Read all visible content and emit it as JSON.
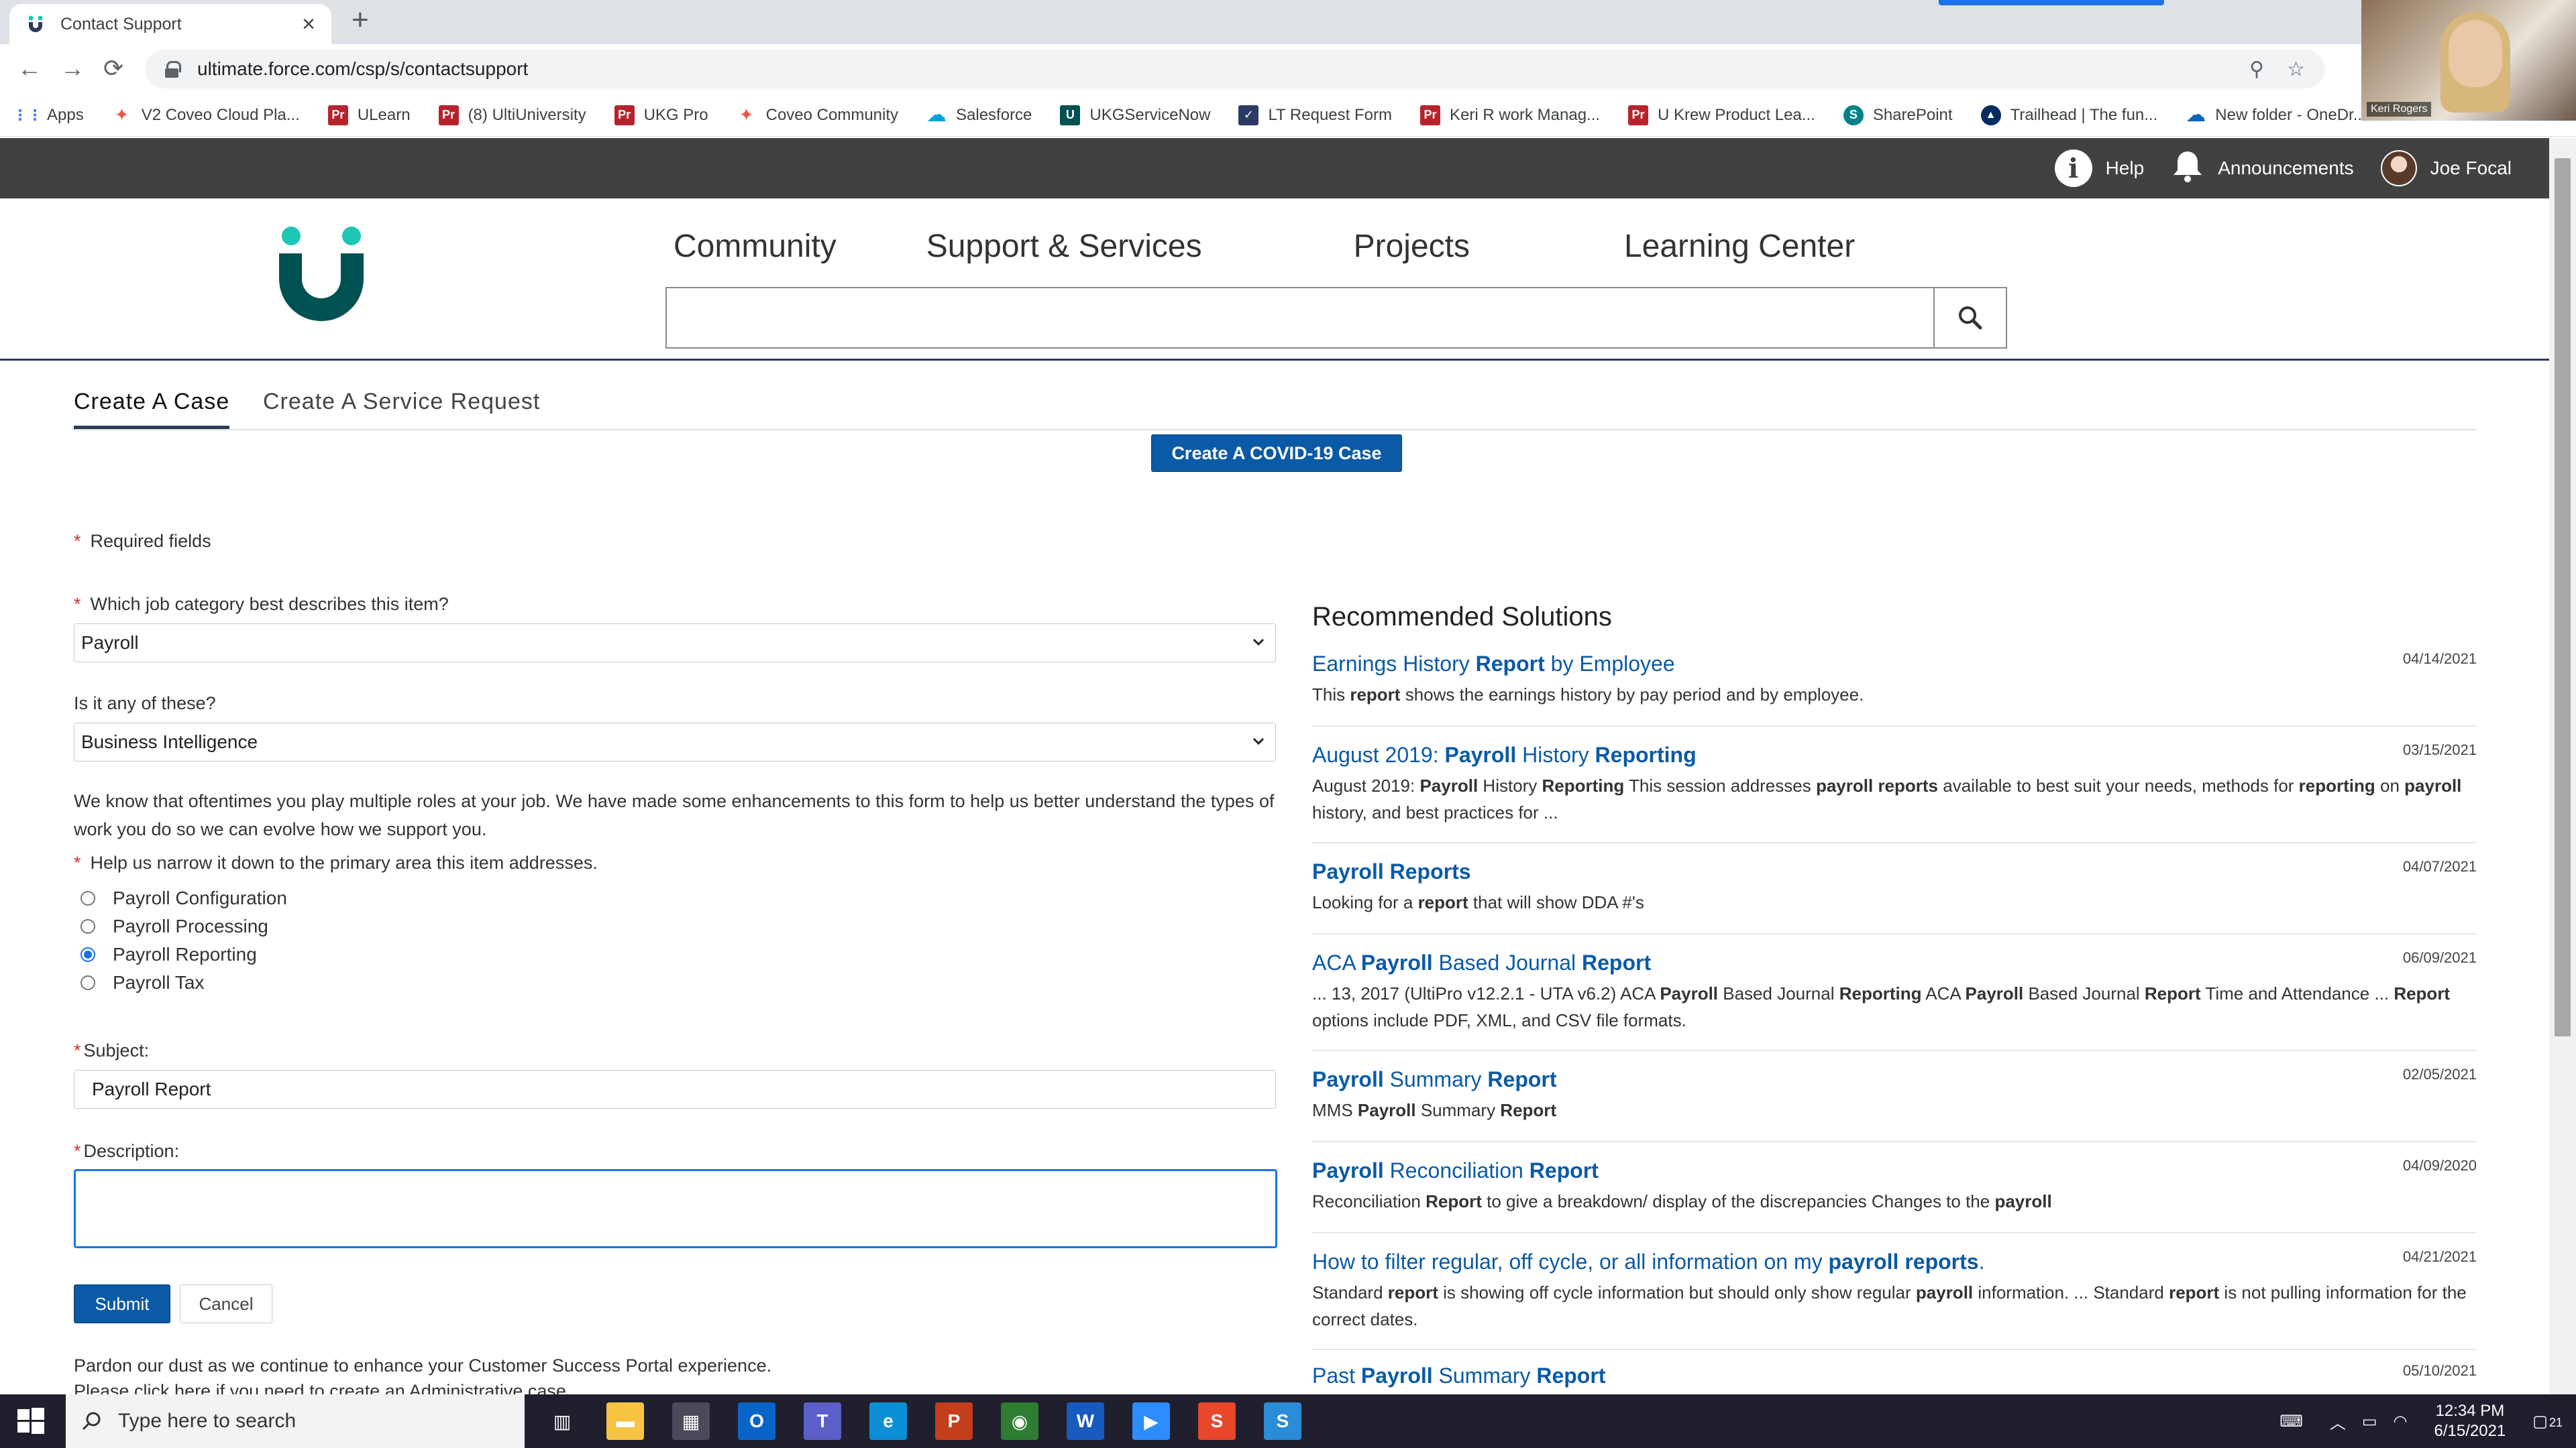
{
  "browser": {
    "tab_title": "Contact Support",
    "url": "ultimate.force.com/csp/s/contactsupport",
    "bookmarks": [
      {
        "label": "Apps",
        "icon": "apps-grid-icon",
        "color": "#4285f4"
      },
      {
        "label": "V2 Coveo Cloud Pla...",
        "icon": "coveo-icon",
        "color": "#f05245"
      },
      {
        "label": "ULearn",
        "icon": "pr-icon",
        "color": "#b7232d"
      },
      {
        "label": "(8) UltiUniversity",
        "icon": "pr-icon",
        "color": "#b7232d"
      },
      {
        "label": "UKG Pro",
        "icon": "pr-icon",
        "color": "#b7232d"
      },
      {
        "label": "Coveo Community",
        "icon": "coveo-icon",
        "color": "#f05245"
      },
      {
        "label": "Salesforce",
        "icon": "salesforce-cloud-icon",
        "color": "#00a1e0"
      },
      {
        "label": "UKGServiceNow",
        "icon": "ukg-icon",
        "color": "#005151"
      },
      {
        "label": "LT Request Form",
        "icon": "form-icon",
        "color": "#2b3a67"
      },
      {
        "label": "Keri R work Manag...",
        "icon": "pr-icon",
        "color": "#b7232d"
      },
      {
        "label": "U Krew Product Lea...",
        "icon": "pr-icon",
        "color": "#b7232d"
      },
      {
        "label": "SharePoint",
        "icon": "sharepoint-icon",
        "color": "#038387"
      },
      {
        "label": "Trailhead | The fun...",
        "icon": "trailhead-icon",
        "color": "#032d60"
      },
      {
        "label": "New folder - OneDr...",
        "icon": "onedrive-icon",
        "color": "#0364b8"
      }
    ],
    "webcam_name": "Keri Rogers"
  },
  "site": {
    "topnav": {
      "help": "Help",
      "announcements": "Announcements",
      "user": "Joe Focal"
    },
    "mainnav": [
      "Community",
      "Support & Services",
      "Projects",
      "Learning Center"
    ],
    "search_placeholder": ""
  },
  "tabs": {
    "create_case": "Create A Case",
    "create_service_request": "Create A Service Request"
  },
  "covid_button": "Create A COVID-19 Case",
  "form": {
    "required_note": "Required fields",
    "q_category": "Which job category best describes this item?",
    "category_value": "Payroll",
    "q_any": "Is it any of these?",
    "any_value": "Business Intelligence",
    "intro": "We know that oftentimes you play multiple roles at your job. We have made some enhancements to this form to help us better understand the types of work you do so we can evolve how we support you.",
    "q_narrow": "Help us narrow it down to the primary area this item addresses.",
    "options": [
      "Payroll Configuration",
      "Payroll Processing",
      "Payroll Reporting",
      "Payroll Tax"
    ],
    "selected_option": "Payroll Reporting",
    "subject_label": "Subject:",
    "subject_value": "Payroll Report",
    "description_label": "Description:",
    "description_value": "",
    "submit": "Submit",
    "cancel": "Cancel",
    "footer1": "Pardon our dust as we continue to enhance your Customer Success Portal experience.",
    "footer2": "Please click here if you need to create an Administrative case."
  },
  "recommended": {
    "title": "Recommended Solutions",
    "items": [
      {
        "title_html": "Earnings History <b>Report</b> by Employee",
        "desc_html": "This <b>report</b> shows the earnings history by pay period and by employee.",
        "date": "04/14/2021"
      },
      {
        "title_html": "August 2019: <b>Payroll</b> History <b>Reporting</b>",
        "desc_html": "August 2019: <b>Payroll</b> History <b>Reporting</b> This session addresses <b>payroll reports</b> available to best suit your needs, methods for <b>reporting</b> on <b>payroll</b> history, and best practices for ...",
        "date": "03/15/2021"
      },
      {
        "title_html": "<b>Payroll Reports</b>",
        "desc_html": "Looking for a <b>report</b> that will show DDA #'s",
        "date": "04/07/2021"
      },
      {
        "title_html": "ACA <b>Payroll</b> Based Journal <b>Report</b>",
        "desc_html": "... 13, 2017 (UltiPro v12.2.1 - UTA v6.2) ACA <b>Payroll</b> Based Journal <b>Reporting</b> ACA <b>Payroll</b> Based Journal <b>Report</b> Time and Attendance ... <b>Report</b> options include PDF, XML, and CSV file formats.",
        "date": "06/09/2021"
      },
      {
        "title_html": "<b>Payroll</b> Summary <b>Report</b>",
        "desc_html": "MMS <b>Payroll</b> Summary <b>Report</b>",
        "date": "02/05/2021"
      },
      {
        "title_html": "<b>Payroll</b> Reconciliation <b>Report</b>",
        "desc_html": "Reconciliation <b>Report</b> to give a breakdown/ display of the discrepancies Changes to the <b>payroll</b>",
        "date": "04/09/2020"
      },
      {
        "title_html": "How to filter regular, off cycle, or all information on my <b>payroll reports</b>.",
        "desc_html": "Standard <b>report</b> is showing off cycle information but should only show regular <b>payroll</b> information. ... Standard <b>report</b> is not pulling information for the correct dates.",
        "date": "04/21/2021"
      },
      {
        "title_html": "Past <b>Payroll</b> Summary <b>Report</b>",
        "desc_html": "",
        "date": "05/10/2021"
      }
    ]
  },
  "taskbar": {
    "search_placeholder": "Type here to search",
    "time": "12:34 PM",
    "date": "6/15/2021",
    "notifications": "21"
  },
  "colors": {
    "brand_dark": "#2e3a59",
    "brand_teal": "#1ec6b6",
    "button_blue": "#0b5aa6",
    "link_blue": "#0b5aa6"
  }
}
